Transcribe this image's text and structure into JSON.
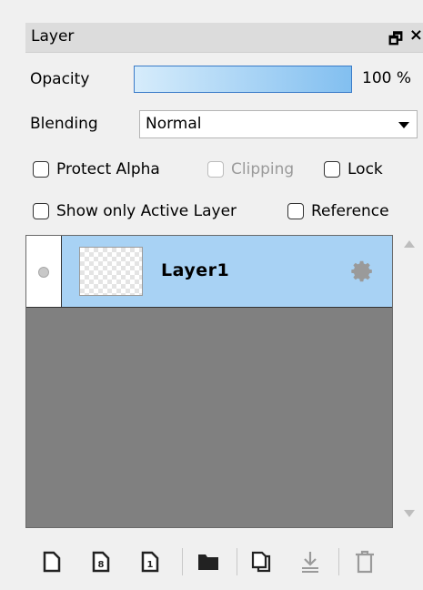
{
  "panel": {
    "title": "Layer",
    "float_icon": "float-window-icon",
    "close_icon": "close-icon"
  },
  "opacity": {
    "label": "Opacity",
    "value_text": "100 %",
    "value_fraction": 1.0
  },
  "blending": {
    "label": "Blending",
    "selected": "Normal"
  },
  "options": {
    "protect_alpha": "Protect Alpha",
    "clipping": "Clipping",
    "lock": "Lock",
    "show_only_active": "Show only Active Layer",
    "reference": "Reference"
  },
  "layers": [
    {
      "name": "Layer1",
      "selected": true
    }
  ],
  "colors": {
    "selected_layer_bg": "#a8d2f4",
    "list_bg": "#808080",
    "opacity_start": "#d6ecfb",
    "opacity_end": "#82bff0"
  },
  "toolbar_icons": [
    "new-layer-icon",
    "new-8bit-layer-icon",
    "new-1bit-layer-icon",
    "new-folder-icon",
    "duplicate-layer-icon",
    "merge-down-icon",
    "delete-layer-icon"
  ]
}
